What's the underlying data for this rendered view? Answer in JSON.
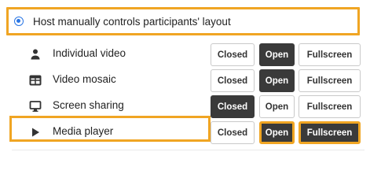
{
  "host": {
    "label": "Host manually controls participants' layout",
    "checked": true
  },
  "buttons": {
    "closed": "Closed",
    "open": "Open",
    "fullscreen": "Fullscreen"
  },
  "rows": [
    {
      "label": "Individual video",
      "icon": "person-icon",
      "active": "open"
    },
    {
      "label": "Video mosaic",
      "icon": "grid-icon",
      "active": "open"
    },
    {
      "label": "Screen sharing",
      "icon": "monitor-icon",
      "active": "closed"
    },
    {
      "label": "Media player",
      "icon": "play-icon",
      "active": "fullscreen"
    }
  ],
  "colors": {
    "highlight": "#f0a523",
    "radio": "#2a76e4",
    "active_button": "#3a3a3a"
  }
}
